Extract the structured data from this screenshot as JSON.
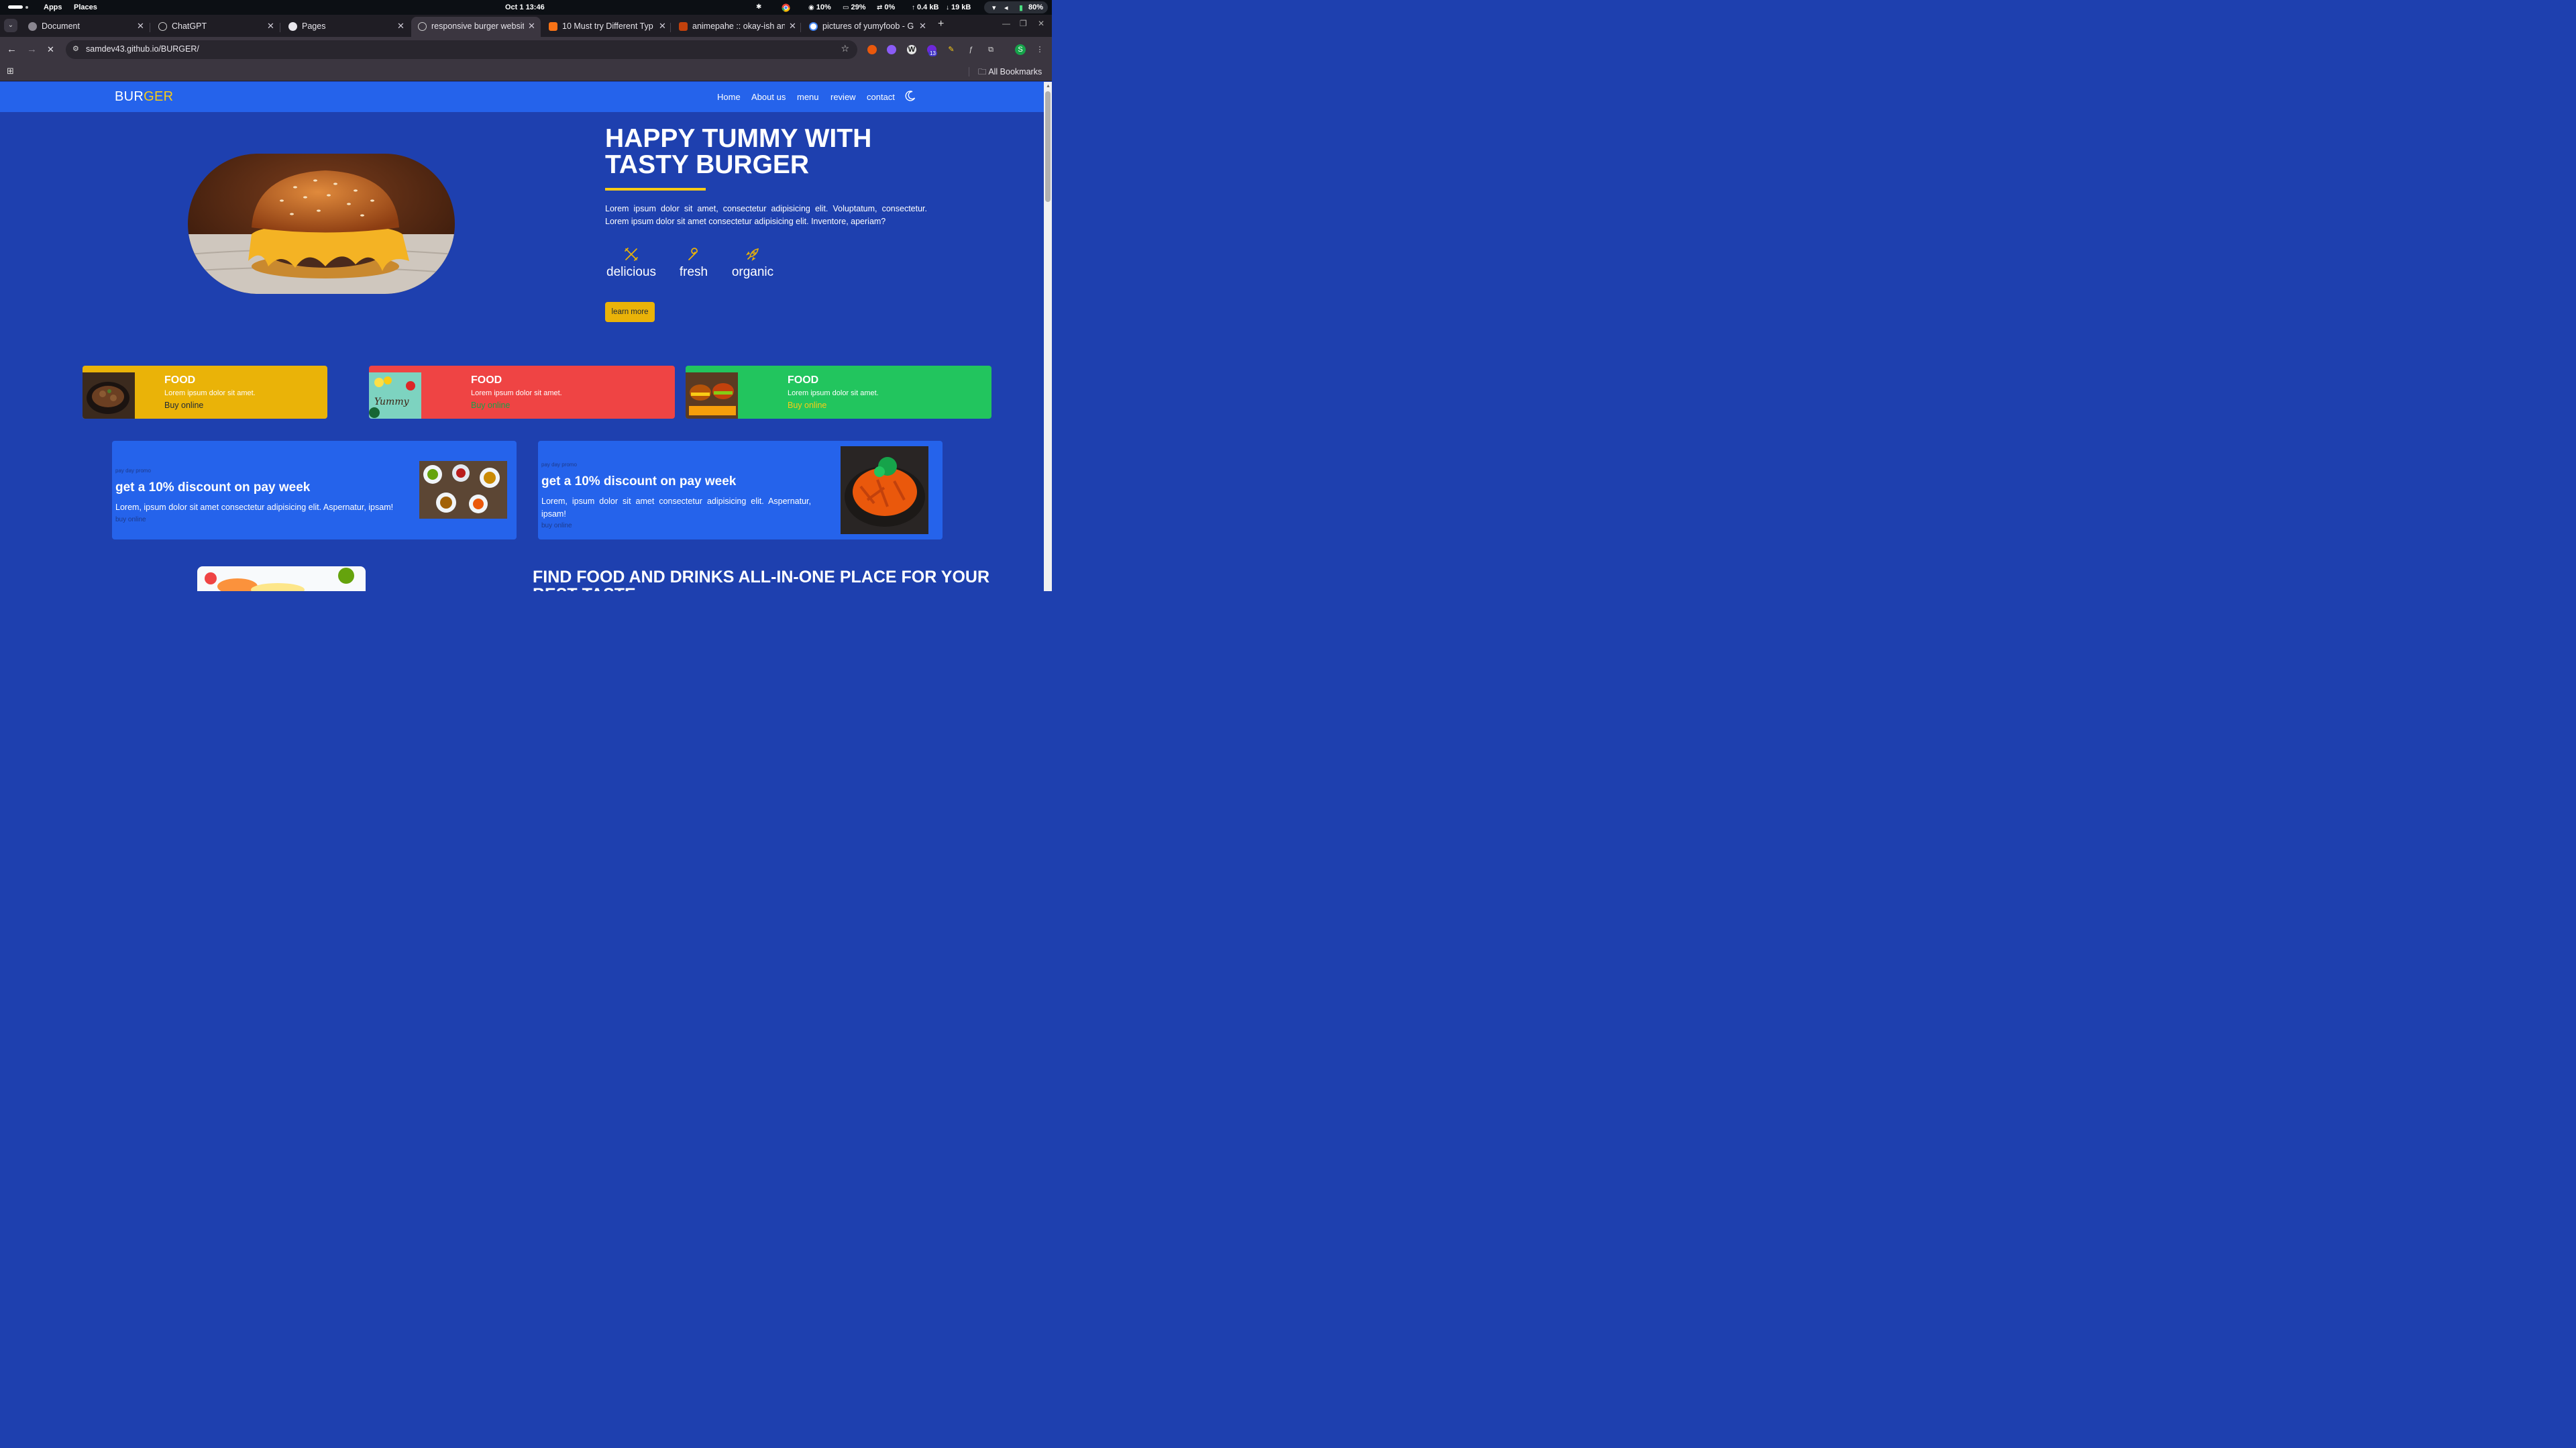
{
  "os": {
    "apps": "Apps",
    "places": "Places",
    "clock": "Oct 1  13:46",
    "cpu": "10%",
    "mem": "29%",
    "swap": "0%",
    "up": "0.4 kB",
    "down": "19 kB",
    "battery": "80%"
  },
  "tabs": [
    {
      "title": "Document"
    },
    {
      "title": "ChatGPT"
    },
    {
      "title": "Pages"
    },
    {
      "title": "responsive burger websit"
    },
    {
      "title": "10 Must try Different Typ"
    },
    {
      "title": "animepahe :: okay-ish an"
    },
    {
      "title": "pictures of yumyfoob - G"
    }
  ],
  "toolbar": {
    "url": "samdev43.github.io/BURGER/",
    "extension_badge": "13",
    "profile": "S"
  },
  "bookmarks": {
    "all": "All Bookmarks"
  },
  "site": {
    "logo_a": "BUR",
    "logo_b": "GER",
    "nav": [
      "Home",
      "About us",
      "menu",
      "review",
      "contact"
    ],
    "hero": {
      "title_line1": "HAPPY TUMMY WITH",
      "title_line2": "TASTY BURGER",
      "text": "Lorem ipsum dolor sit amet, consectetur adipisicing elit. Voluptatum, consectetur. Lorem ipsum dolor sit amet consectetur adipisicing elit. Inventore, aperiam?",
      "features": [
        "delicious",
        "fresh",
        "organic"
      ],
      "button": "learn more"
    },
    "food_cards": [
      {
        "title": "FOOD",
        "text": "Lorem ipsum dolor sit amet.",
        "link": "Buy online",
        "color": "#eab308",
        "link_color": "#1f2937"
      },
      {
        "title": "FOOD",
        "text": "Lorem ipsum dolor sit amet.",
        "link": "Buy online",
        "color": "#ef4444",
        "link_color": "#16a34a"
      },
      {
        "title": "FOOD",
        "text": "Lorem ipsum dolor sit amet.",
        "link": "Buy online",
        "color": "#22c55e",
        "link_color": "#facc15"
      }
    ],
    "promos": [
      {
        "day": "pay day promo",
        "title": "get a 10% discount on pay week",
        "text": "Lorem, ipsum dolor sit amet consectetur adipisicing elit. Aspernatur, ipsam!",
        "link": "buy online"
      },
      {
        "day": "pay day promo",
        "title": "get a 10% discount on pay week",
        "text": "Lorem, ipsum dolor sit amet consectetur adipisicing elit. Aspernatur, ipsam!",
        "link": "buy online"
      }
    ],
    "find_title_line1": "FIND FOOD AND DRINKS ALL-IN-ONE PLACE FOR YOUR",
    "find_title_line2": "BEST TASTE"
  }
}
